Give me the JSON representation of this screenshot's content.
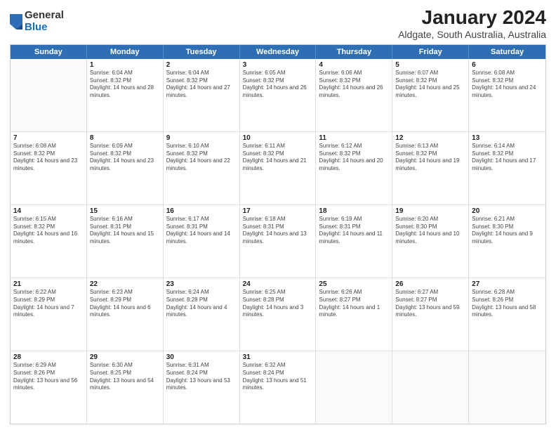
{
  "logo": {
    "general": "General",
    "blue": "Blue"
  },
  "title": "January 2024",
  "subtitle": "Aldgate, South Australia, Australia",
  "header_days": [
    "Sunday",
    "Monday",
    "Tuesday",
    "Wednesday",
    "Thursday",
    "Friday",
    "Saturday"
  ],
  "weeks": [
    [
      {
        "day": "",
        "empty": true
      },
      {
        "day": "1",
        "sunrise": "6:04 AM",
        "sunset": "8:32 PM",
        "daylight": "14 hours and 28 minutes."
      },
      {
        "day": "2",
        "sunrise": "6:04 AM",
        "sunset": "8:32 PM",
        "daylight": "14 hours and 27 minutes."
      },
      {
        "day": "3",
        "sunrise": "6:05 AM",
        "sunset": "8:32 PM",
        "daylight": "14 hours and 26 minutes."
      },
      {
        "day": "4",
        "sunrise": "6:06 AM",
        "sunset": "8:32 PM",
        "daylight": "14 hours and 26 minutes."
      },
      {
        "day": "5",
        "sunrise": "6:07 AM",
        "sunset": "8:32 PM",
        "daylight": "14 hours and 25 minutes."
      },
      {
        "day": "6",
        "sunrise": "6:08 AM",
        "sunset": "8:32 PM",
        "daylight": "14 hours and 24 minutes."
      }
    ],
    [
      {
        "day": "7",
        "sunrise": "6:08 AM",
        "sunset": "8:32 PM",
        "daylight": "14 hours and 23 minutes."
      },
      {
        "day": "8",
        "sunrise": "6:09 AM",
        "sunset": "8:32 PM",
        "daylight": "14 hours and 23 minutes."
      },
      {
        "day": "9",
        "sunrise": "6:10 AM",
        "sunset": "8:32 PM",
        "daylight": "14 hours and 22 minutes."
      },
      {
        "day": "10",
        "sunrise": "6:11 AM",
        "sunset": "8:32 PM",
        "daylight": "14 hours and 21 minutes."
      },
      {
        "day": "11",
        "sunrise": "6:12 AM",
        "sunset": "8:32 PM",
        "daylight": "14 hours and 20 minutes."
      },
      {
        "day": "12",
        "sunrise": "6:13 AM",
        "sunset": "8:32 PM",
        "daylight": "14 hours and 19 minutes."
      },
      {
        "day": "13",
        "sunrise": "6:14 AM",
        "sunset": "8:32 PM",
        "daylight": "14 hours and 17 minutes."
      }
    ],
    [
      {
        "day": "14",
        "sunrise": "6:15 AM",
        "sunset": "8:32 PM",
        "daylight": "14 hours and 16 minutes."
      },
      {
        "day": "15",
        "sunrise": "6:16 AM",
        "sunset": "8:31 PM",
        "daylight": "14 hours and 15 minutes."
      },
      {
        "day": "16",
        "sunrise": "6:17 AM",
        "sunset": "8:31 PM",
        "daylight": "14 hours and 14 minutes."
      },
      {
        "day": "17",
        "sunrise": "6:18 AM",
        "sunset": "8:31 PM",
        "daylight": "14 hours and 13 minutes."
      },
      {
        "day": "18",
        "sunrise": "6:19 AM",
        "sunset": "8:31 PM",
        "daylight": "14 hours and 11 minutes."
      },
      {
        "day": "19",
        "sunrise": "6:20 AM",
        "sunset": "8:30 PM",
        "daylight": "14 hours and 10 minutes."
      },
      {
        "day": "20",
        "sunrise": "6:21 AM",
        "sunset": "8:30 PM",
        "daylight": "14 hours and 9 minutes."
      }
    ],
    [
      {
        "day": "21",
        "sunrise": "6:22 AM",
        "sunset": "8:29 PM",
        "daylight": "14 hours and 7 minutes."
      },
      {
        "day": "22",
        "sunrise": "6:23 AM",
        "sunset": "8:29 PM",
        "daylight": "14 hours and 6 minutes."
      },
      {
        "day": "23",
        "sunrise": "6:24 AM",
        "sunset": "8:28 PM",
        "daylight": "14 hours and 4 minutes."
      },
      {
        "day": "24",
        "sunrise": "6:25 AM",
        "sunset": "8:28 PM",
        "daylight": "14 hours and 3 minutes."
      },
      {
        "day": "25",
        "sunrise": "6:26 AM",
        "sunset": "8:27 PM",
        "daylight": "14 hours and 1 minute."
      },
      {
        "day": "26",
        "sunrise": "6:27 AM",
        "sunset": "8:27 PM",
        "daylight": "13 hours and 59 minutes."
      },
      {
        "day": "27",
        "sunrise": "6:28 AM",
        "sunset": "8:26 PM",
        "daylight": "13 hours and 58 minutes."
      }
    ],
    [
      {
        "day": "28",
        "sunrise": "6:29 AM",
        "sunset": "8:26 PM",
        "daylight": "13 hours and 56 minutes."
      },
      {
        "day": "29",
        "sunrise": "6:30 AM",
        "sunset": "8:25 PM",
        "daylight": "13 hours and 54 minutes."
      },
      {
        "day": "30",
        "sunrise": "6:31 AM",
        "sunset": "8:24 PM",
        "daylight": "13 hours and 53 minutes."
      },
      {
        "day": "31",
        "sunrise": "6:32 AM",
        "sunset": "8:24 PM",
        "daylight": "13 hours and 51 minutes."
      },
      {
        "day": "",
        "empty": true
      },
      {
        "day": "",
        "empty": true
      },
      {
        "day": "",
        "empty": true
      }
    ]
  ]
}
